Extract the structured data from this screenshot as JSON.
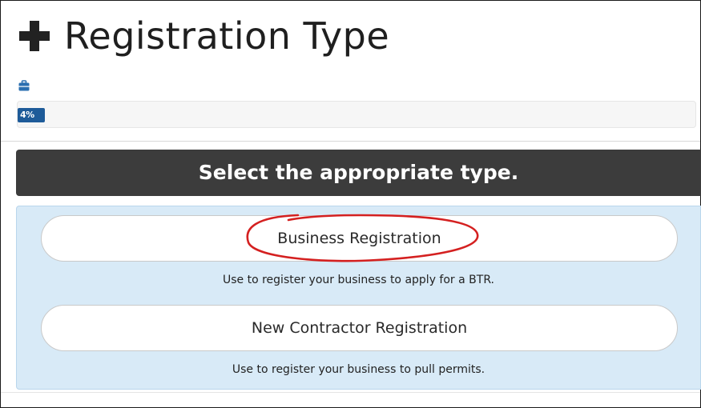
{
  "header": {
    "title": "Registration Type",
    "plus_icon": "plus-icon"
  },
  "progress": {
    "icon": "briefcase-icon",
    "label": "4%",
    "percent": 4,
    "fill_color": "#1e5b99"
  },
  "section": {
    "heading": "Select the appropriate type."
  },
  "options": [
    {
      "label": "Business Registration",
      "description": "Use to register your business to apply for a BTR.",
      "annotated": true
    },
    {
      "label": "New Contractor Registration",
      "description": "Use to register your business to pull permits."
    }
  ],
  "colors": {
    "header_bg": "#3c3c3c",
    "panel_bg": "#d8eaf7",
    "annotation": "#d42020",
    "icon_blue": "#2a6fb0"
  }
}
